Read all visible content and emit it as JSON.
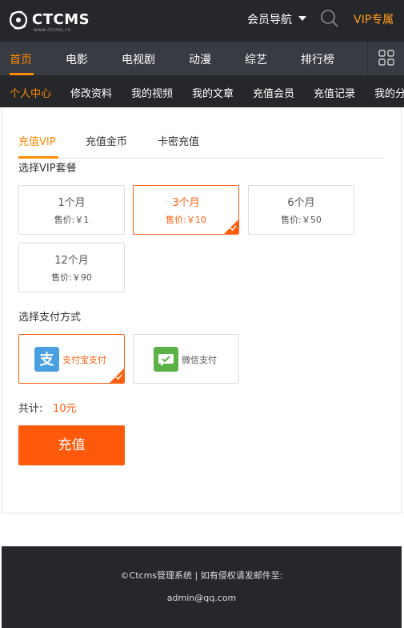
{
  "header": {
    "logo_text": "CTCMS",
    "logo_sub": "www.ctcms.cn",
    "member_nav": "会员导航",
    "vip_link": "VIP专属",
    "icons": {
      "search": "search-icon",
      "caret": "caret-down-icon",
      "logo": "film-reel-icon"
    }
  },
  "main_nav": {
    "items": [
      "首页",
      "电影",
      "电视剧",
      "动漫",
      "综艺",
      "排行榜"
    ],
    "active_index": 0,
    "more_icon": "grid-icon"
  },
  "sub_nav": {
    "items": [
      "个人中心",
      "修改资料",
      "我的视频",
      "我的文章",
      "充值会员",
      "充值记录",
      "我的分"
    ],
    "active_index": 0
  },
  "tabs": {
    "items": [
      "充值VIP",
      "充值金币",
      "卡密充值"
    ],
    "active_index": 0
  },
  "plans": {
    "label": "选择VIP套餐",
    "items": [
      {
        "name": "1个月",
        "price": "售价:￥1"
      },
      {
        "name": "3个月",
        "price": "售价:￥10"
      },
      {
        "name": "6个月",
        "price": "售价:￥50"
      },
      {
        "name": "12个月",
        "price": "售价:￥90"
      }
    ],
    "selected_index": 1
  },
  "payment": {
    "label": "选择支付方式",
    "items": [
      {
        "name": "支付宝支付",
        "icon": "alipay-icon"
      },
      {
        "name": "微信支付",
        "icon": "wechat-pay-icon"
      }
    ],
    "selected_index": 0
  },
  "total": {
    "label": "共计:",
    "amount": "10元"
  },
  "recharge_button": "充值",
  "footer": {
    "line1": "©Ctcms管理系统 | 如有侵权请发邮件至:",
    "line2": "admin@qq.com"
  },
  "colors": {
    "accent": "#ff8a00",
    "selected": "#ff5f0f",
    "button": "#ff5a0b",
    "header_bg": "#25272b",
    "nav_bg": "#393b42",
    "alipay": "#4a9fe0",
    "wechat": "#5bb145"
  }
}
